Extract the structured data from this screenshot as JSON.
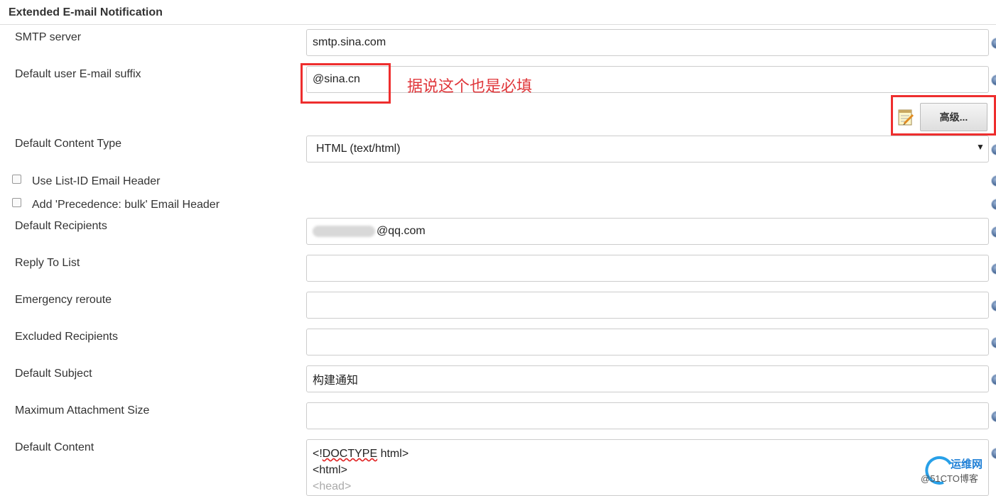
{
  "section": {
    "title": "Extended E-mail Notification"
  },
  "fields": {
    "smtp_server": {
      "label": "SMTP server",
      "value": "smtp.sina.com"
    },
    "default_suffix": {
      "label": "Default user E-mail suffix",
      "value": "@sina.cn"
    },
    "content_type": {
      "label": "Default Content Type",
      "value": "HTML (text/html)"
    },
    "list_id": {
      "label": "Use List-ID Email Header"
    },
    "precedence": {
      "label": "Add 'Precedence: bulk' Email Header"
    },
    "recipients": {
      "label": "Default Recipients",
      "value": "@qq.com"
    },
    "reply_to": {
      "label": "Reply To List",
      "value": ""
    },
    "emergency": {
      "label": "Emergency reroute",
      "value": ""
    },
    "excluded": {
      "label": "Excluded Recipients",
      "value": ""
    },
    "subject": {
      "label": "Default Subject",
      "value": "构建通知"
    },
    "max_attach": {
      "label": "Maximum Attachment Size",
      "value": ""
    },
    "content": {
      "label": "Default Content",
      "line1_prefix": "<!",
      "line1_word": "DOCTYPE",
      "line1_suffix": " html>",
      "line2": "<html>",
      "line3": "<head>"
    }
  },
  "annotation": {
    "text": "据说这个也是必填"
  },
  "advanced_button": {
    "label": "高级..."
  },
  "watermark": {
    "line1": "运维网",
    "line2": "@51CTO博客"
  },
  "icons": {
    "help": "help-icon",
    "notepad": "notepad-icon",
    "dropdown": "chevron-down-icon"
  },
  "colors": {
    "annotation": "#e0373b",
    "help": "#4f6f9c",
    "border": "#cccccc"
  }
}
